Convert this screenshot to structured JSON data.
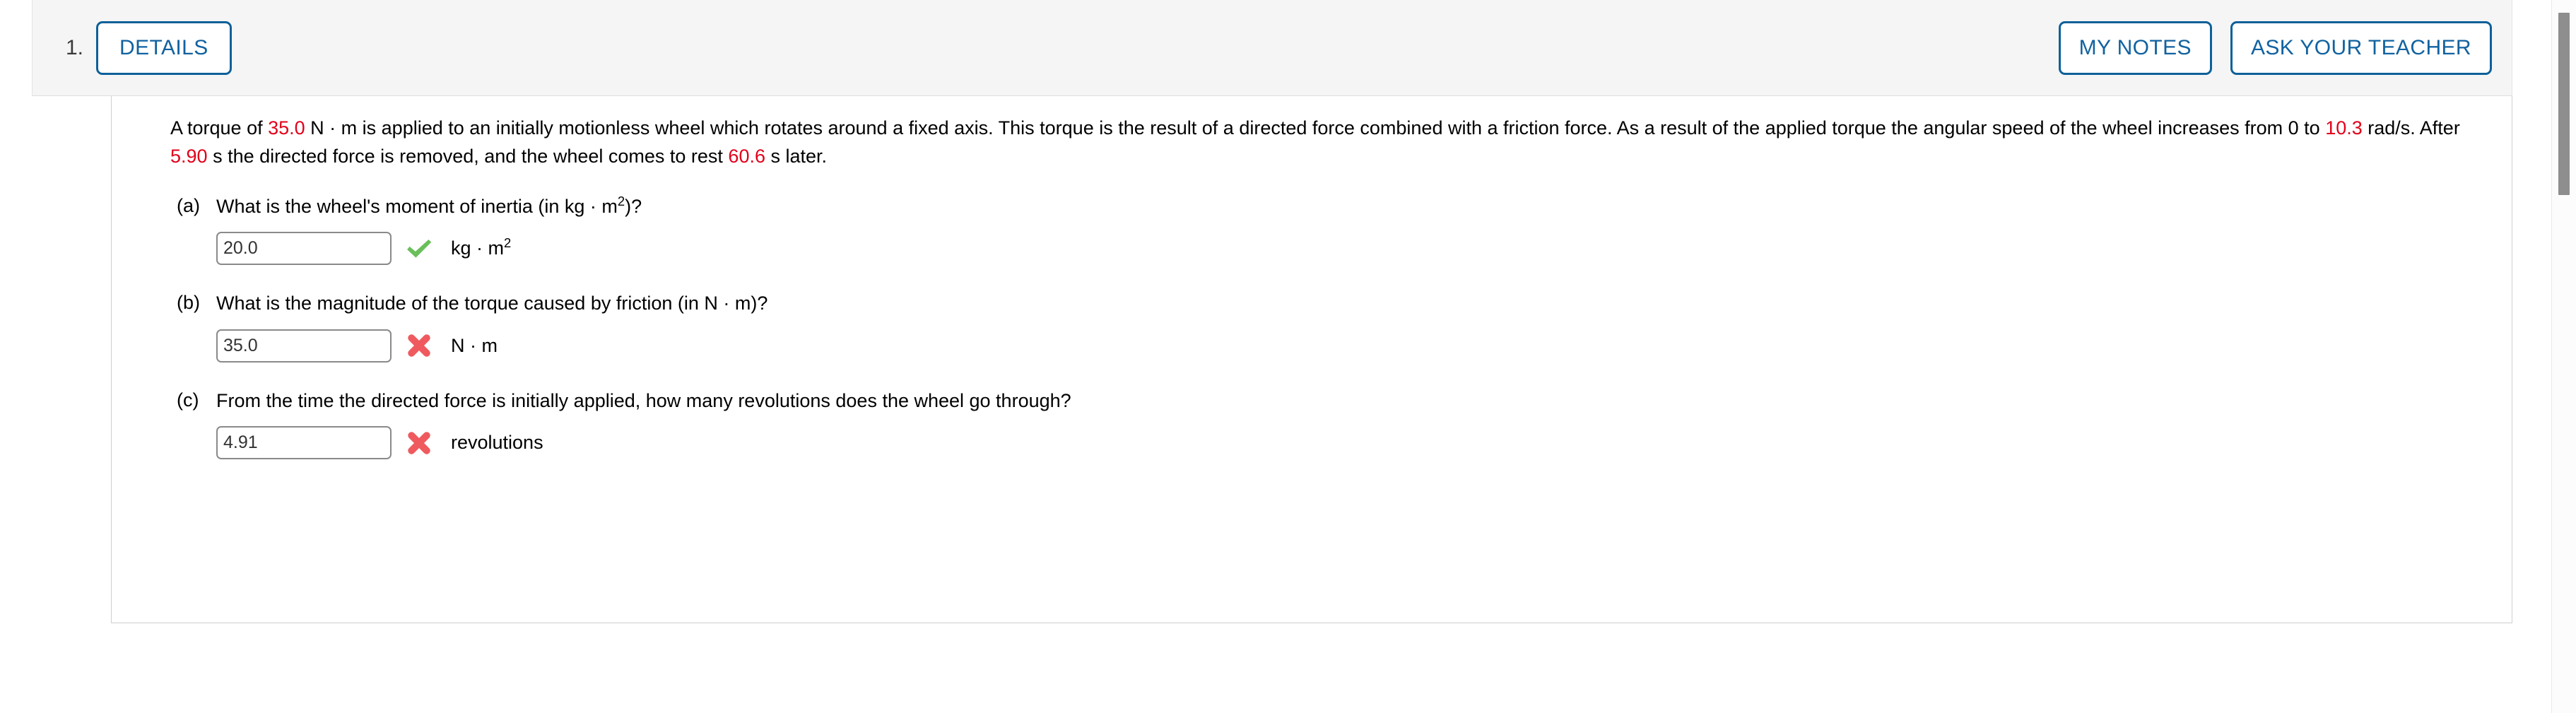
{
  "header": {
    "question_number": "1.",
    "details_label": "DETAILS",
    "my_notes_label": "MY NOTES",
    "ask_your_teacher_label": "ASK YOUR TEACHER",
    "accent_color": "#0e6099"
  },
  "problem": {
    "segments": [
      {
        "text": "A torque of ",
        "highlight": false
      },
      {
        "text": "35.0",
        "highlight": true
      },
      {
        "text": " N · m is applied to an initially motionless wheel which rotates around a fixed axis. This torque is the result of a directed force combined with a friction force. As a result of the applied torque the angular speed of the wheel increases from 0 to ",
        "highlight": false
      },
      {
        "text": "10.3",
        "highlight": true
      },
      {
        "text": " rad/s. After ",
        "highlight": false
      },
      {
        "text": "5.90",
        "highlight": true
      },
      {
        "text": " s the directed force is removed, and the wheel comes to rest ",
        "highlight": false
      },
      {
        "text": "60.6",
        "highlight": true
      },
      {
        "text": " s later.",
        "highlight": false
      }
    ],
    "highlight_color": "#e2001a"
  },
  "parts": [
    {
      "label": "(a)",
      "question_prefix": "What is the wheel's moment of inertia (in kg · m",
      "question_exponent": "2",
      "question_suffix": ")?",
      "answer_value": "20.0",
      "status": "correct",
      "status_icon": "green-check-icon",
      "status_color": "#6abf5a",
      "unit_prefix": "kg · m",
      "unit_exponent": "2",
      "unit_suffix": ""
    },
    {
      "label": "(b)",
      "question_prefix": "What is the magnitude of the torque caused by friction (in N · m)?",
      "question_exponent": "",
      "question_suffix": "",
      "answer_value": "35.0",
      "status": "incorrect",
      "status_icon": "red-cross-icon",
      "status_color": "#ef5a5f",
      "unit_prefix": "N · m",
      "unit_exponent": "",
      "unit_suffix": ""
    },
    {
      "label": "(c)",
      "question_prefix": "From the time the directed force is initially applied, how many revolutions does the wheel go through?",
      "question_exponent": "",
      "question_suffix": "",
      "answer_value": "4.91",
      "status": "incorrect",
      "status_icon": "red-cross-icon",
      "status_color": "#ef5a5f",
      "unit_prefix": "revolutions",
      "unit_exponent": "",
      "unit_suffix": ""
    }
  ],
  "scrollbar": {
    "orientation": "vertical",
    "thumb_color": "#8e8e8e"
  }
}
